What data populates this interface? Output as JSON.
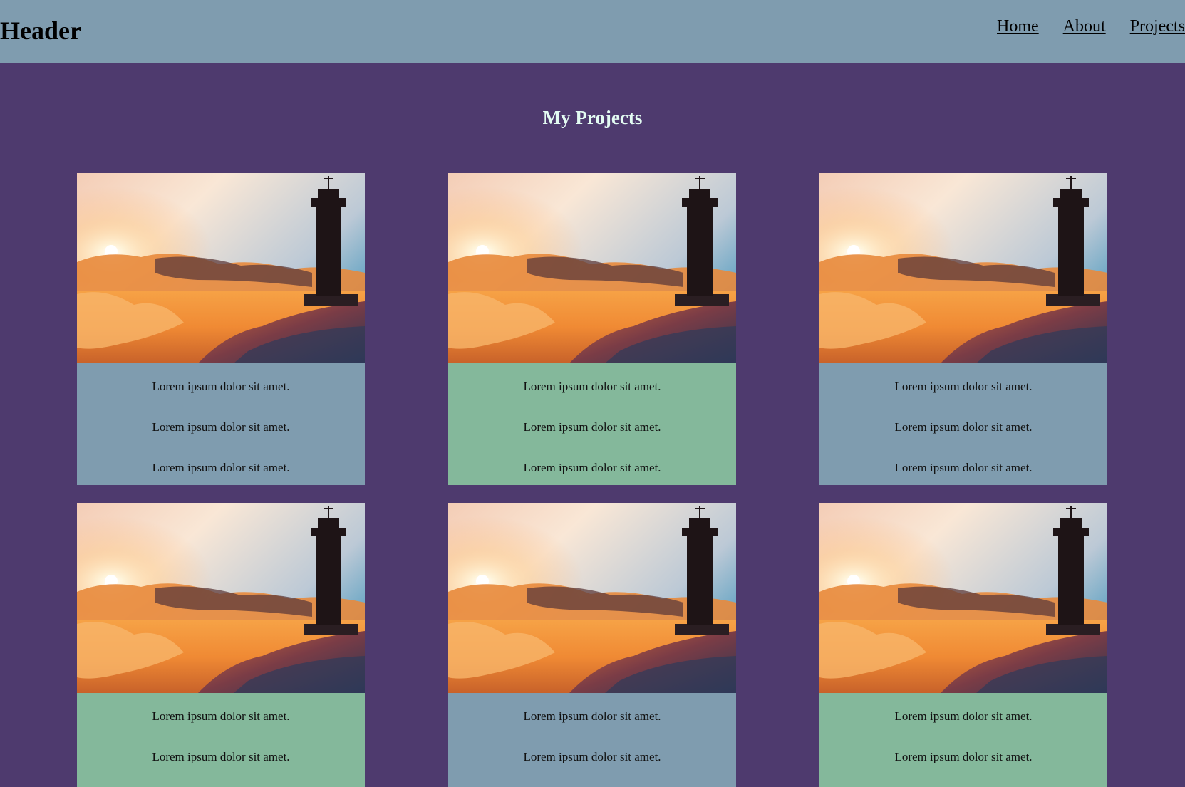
{
  "header": {
    "title": "Header",
    "nav": [
      "Home",
      "About",
      "Projects"
    ]
  },
  "main": {
    "heading": "My Projects",
    "cards": [
      {
        "lines": [
          "Lorem ipsum dolor sit amet.",
          "Lorem ipsum dolor sit amet.",
          "Lorem ipsum dolor sit amet."
        ]
      },
      {
        "lines": [
          "Lorem ipsum dolor sit amet.",
          "Lorem ipsum dolor sit amet.",
          "Lorem ipsum dolor sit amet."
        ]
      },
      {
        "lines": [
          "Lorem ipsum dolor sit amet.",
          "Lorem ipsum dolor sit amet.",
          "Lorem ipsum dolor sit amet."
        ]
      },
      {
        "lines": [
          "Lorem ipsum dolor sit amet.",
          "Lorem ipsum dolor sit amet."
        ]
      },
      {
        "lines": [
          "Lorem ipsum dolor sit amet.",
          "Lorem ipsum dolor sit amet."
        ]
      },
      {
        "lines": [
          "Lorem ipsum dolor sit amet.",
          "Lorem ipsum dolor sit amet."
        ]
      }
    ]
  },
  "colors": {
    "page_background": "#4e3a6e",
    "header_background": "#7f9caf",
    "card_blue": "#7f9caf",
    "card_green": "#84b89b",
    "heading_text": "#e3fbf2"
  }
}
